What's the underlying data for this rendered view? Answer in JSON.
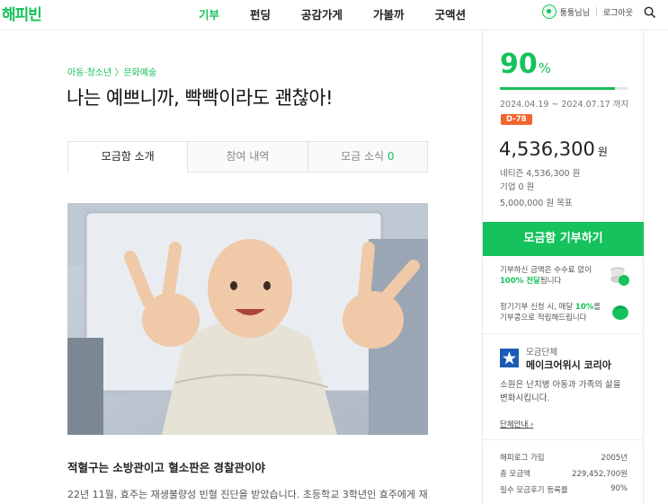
{
  "header": {
    "logo": "해피빈",
    "nav": [
      "기부",
      "펀딩",
      "공감가게",
      "가볼까",
      "굿액션"
    ],
    "user_name": "퉁퉁님님",
    "logout": "로그아웃"
  },
  "campaign": {
    "category": "아동·청소년 〉문화예술",
    "title": "나는 예쁘니까, 빡빡이라도 괜찮아!",
    "tabs": {
      "intro": "모금함 소개",
      "history": "참여 내역",
      "news_label": "모금 소식",
      "news_count": "0"
    },
    "section_heading": "적혈구는 소방관이고 혈소판은 경찰관이야",
    "body_text": "22년 11월, 효주는 재생불량성 빈혈 진단을 받았습니다. 초등학교 3학년인 효주에게 재"
  },
  "funding": {
    "percent": "90",
    "percent_unit": "%",
    "progress": 0.9,
    "period": "2024.04.19 ~ 2024.07.17 까지",
    "dday": "D-78",
    "amount": "4,536,300",
    "amount_unit": "원",
    "netizen": "네티즌 4,536,300 원",
    "company": "기업 0 원",
    "goal": "5,000,000 원 목표"
  },
  "donate_button": "모금함 기부하기",
  "info": {
    "fee_pre": "기부하신 금액은 수수료 없이",
    "fee_strong": "100% 전달",
    "fee_post": "됩니다",
    "regular_pre": "정기기부 신청 시, 매달",
    "regular_strong": "10%",
    "regular_post": "를",
    "regular_line2": "기부콩으로 적립해드립니다"
  },
  "organization": {
    "label": "모금단체",
    "name": "메이크어위시 코리아",
    "description": "소원은 난치병 아동과 가족의 삶을 변화시킵니다.",
    "link": "단체안내 ›",
    "stats": [
      {
        "label": "해피로그 가입",
        "value": "2005년"
      },
      {
        "label": "총 모금액",
        "value": "229,452,700원"
      },
      {
        "label": "필수 모금후기 등록률",
        "value": "90%"
      }
    ]
  },
  "colors": {
    "accent": "#16c25b",
    "dday": "#f0642d",
    "org_logo": "#1c5bb5"
  }
}
